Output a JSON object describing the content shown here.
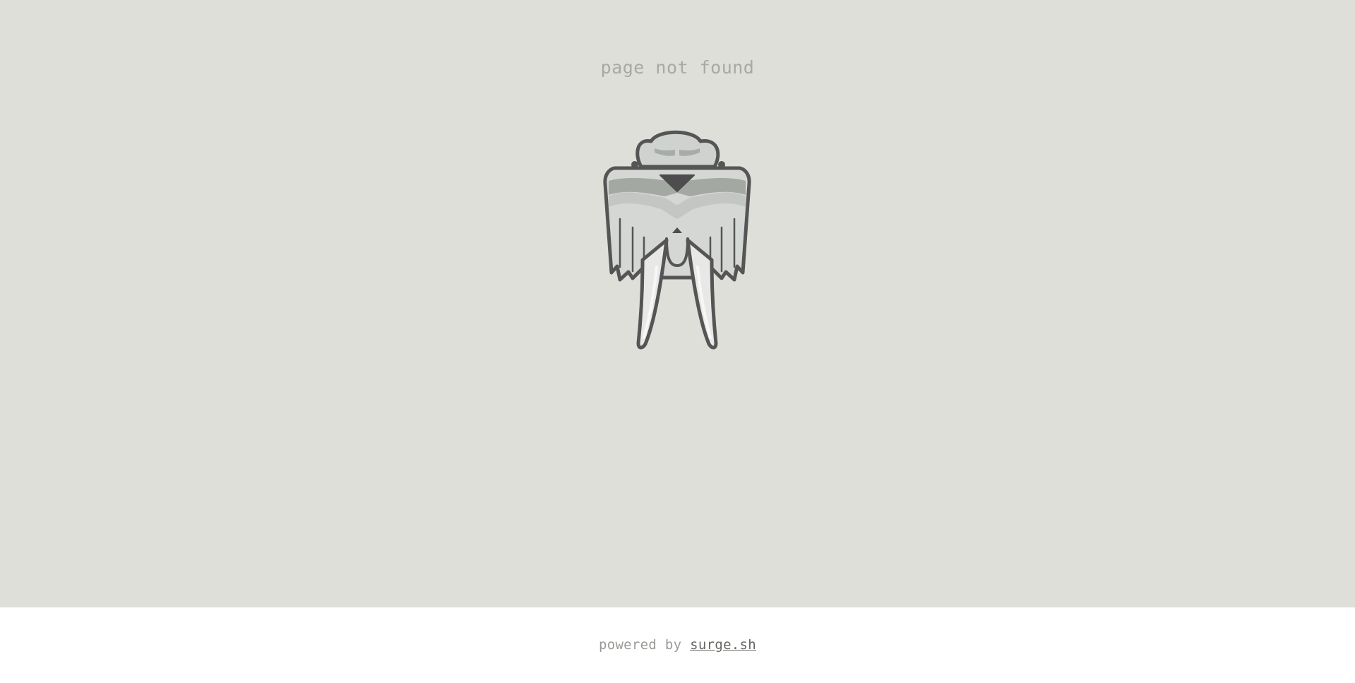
{
  "page": {
    "title": "page not found",
    "illustration_icon": "walrus-icon"
  },
  "footer": {
    "prefix": "powered by ",
    "link_label": "surge.sh"
  },
  "colors": {
    "background": "#dfdfda",
    "footer_background": "#ffffff",
    "title_text": "#a8a8a4",
    "footer_text": "#999995",
    "link_text": "#666663",
    "outline": "#555555"
  }
}
